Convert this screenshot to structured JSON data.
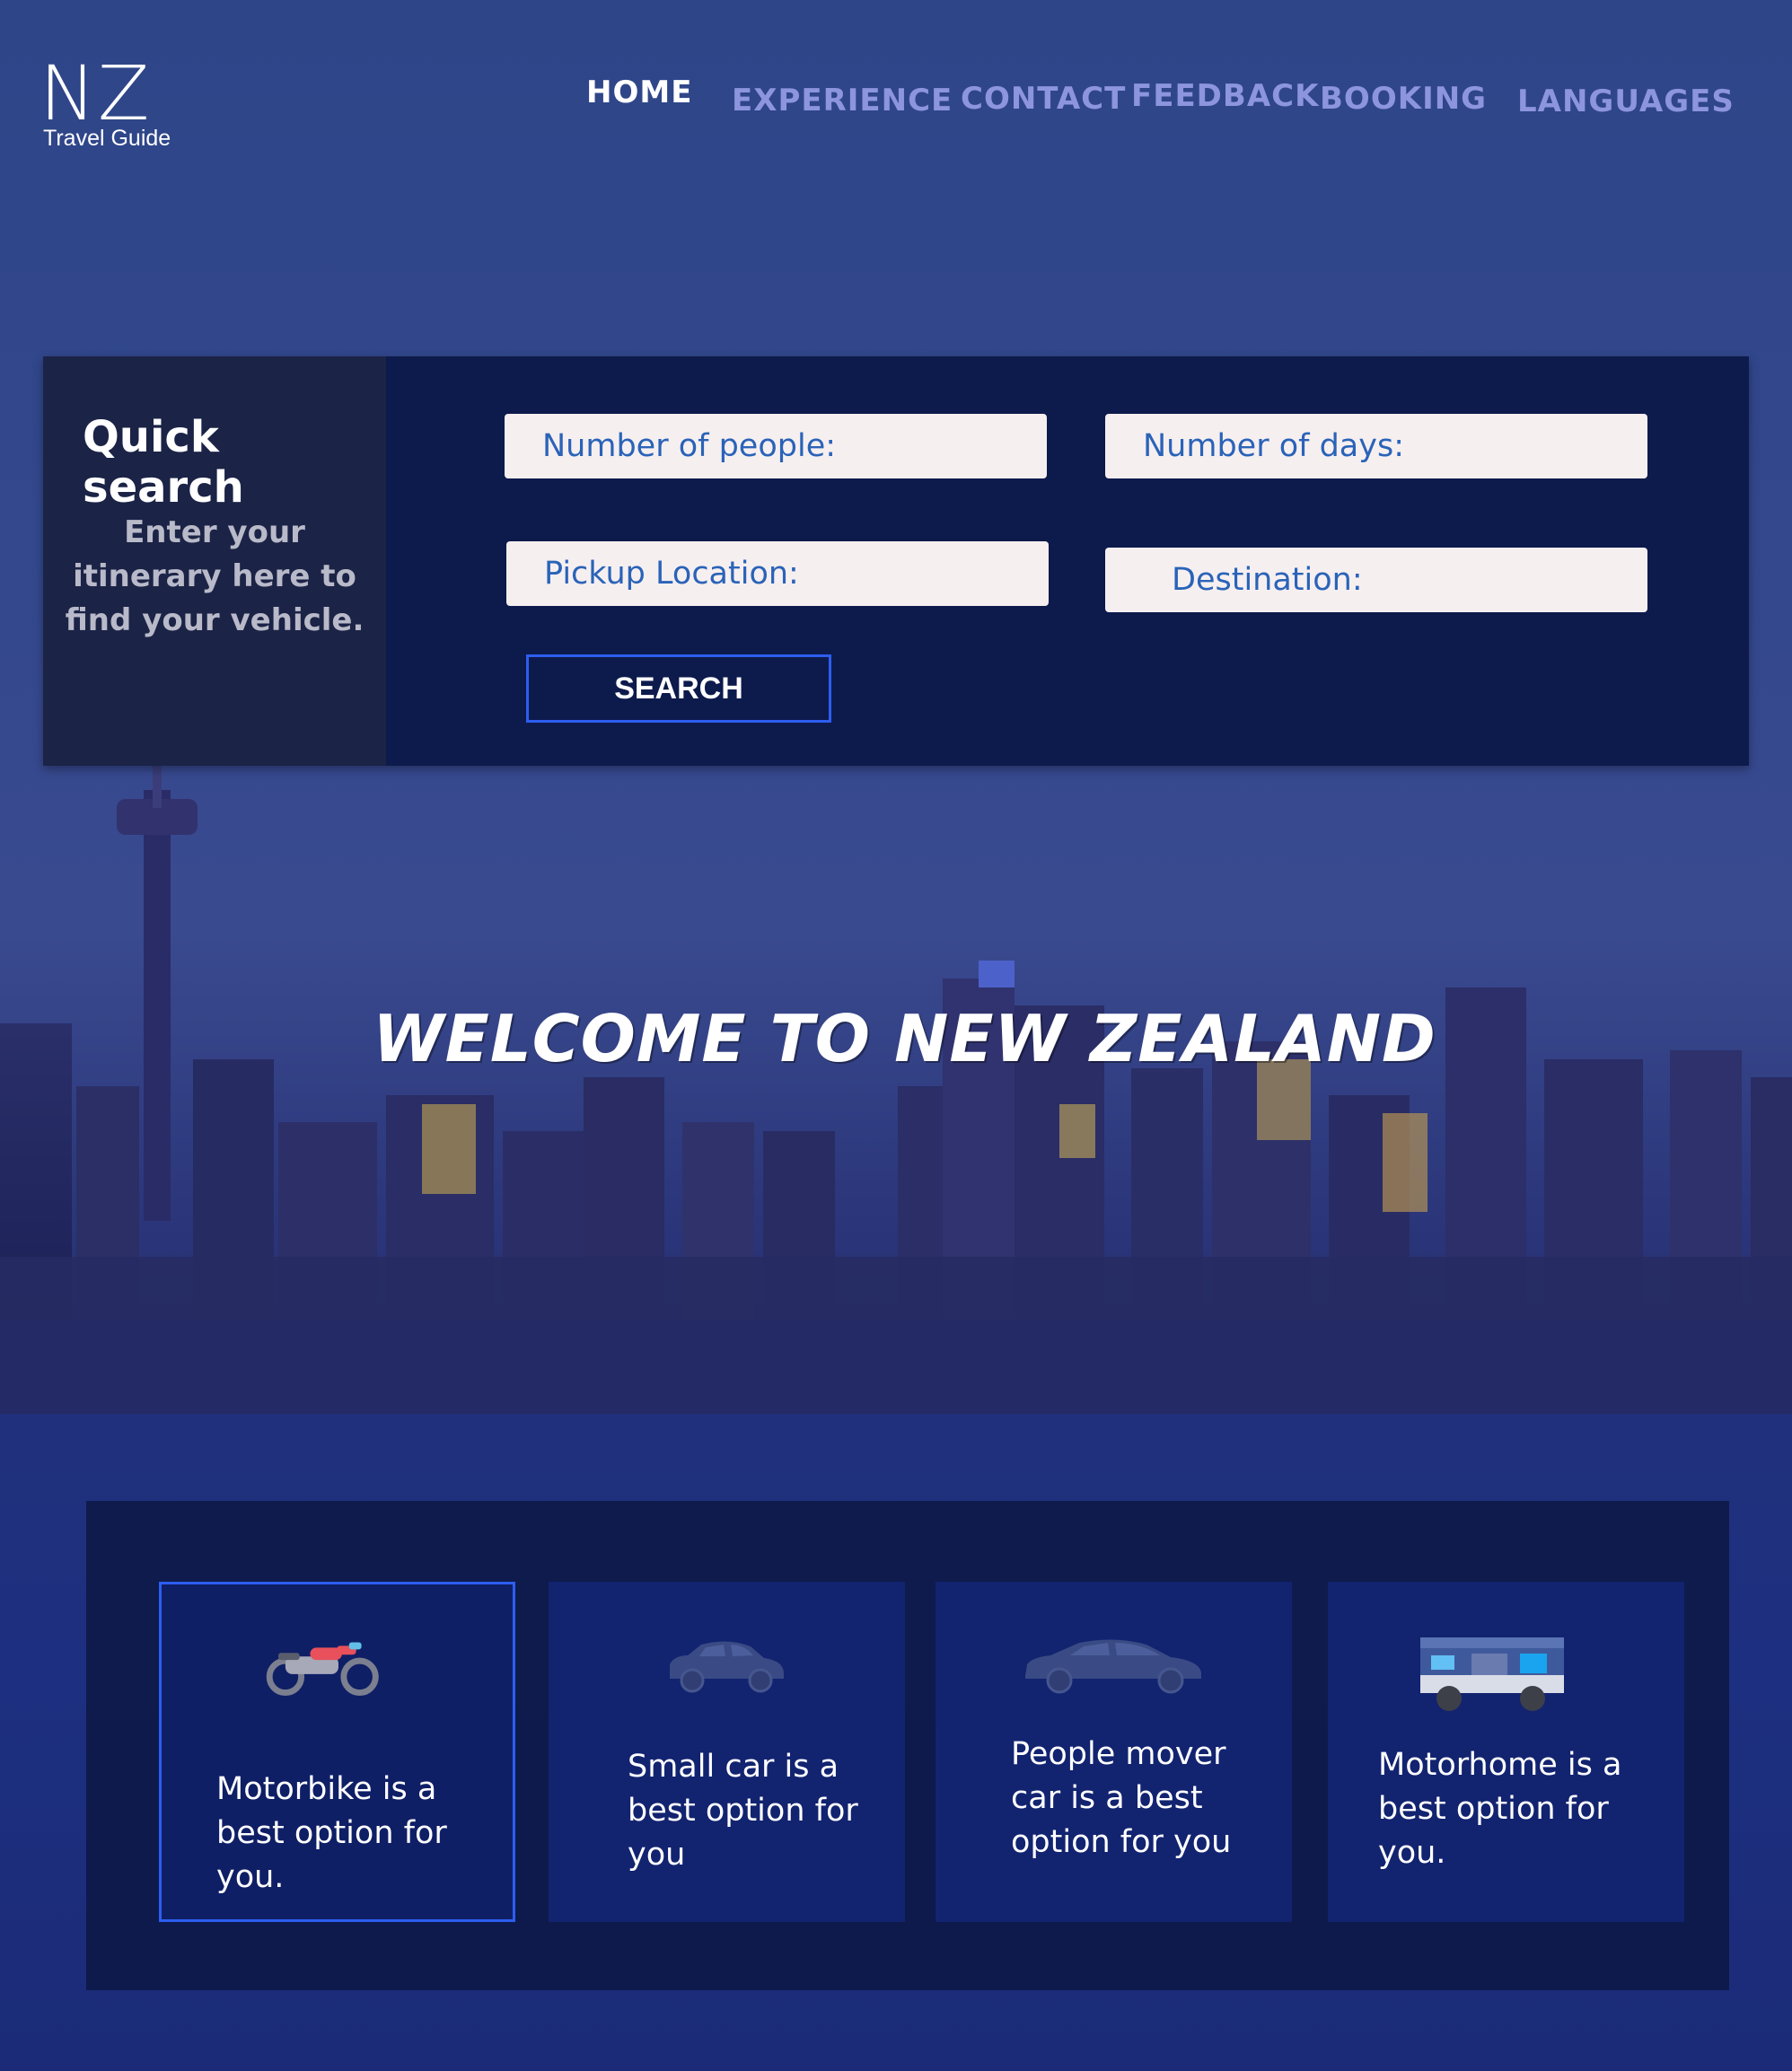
{
  "logo": {
    "mark": "NZ",
    "subtitle": "Travel Guide"
  },
  "nav": {
    "items": [
      {
        "label": "HOME",
        "active": true
      },
      {
        "label": "EXPERIENCE",
        "active": false
      },
      {
        "label": "CONTACT",
        "active": false
      },
      {
        "label": "FEEDBACK",
        "active": false
      },
      {
        "label": "BOOKING",
        "active": false
      },
      {
        "label": "LANGUAGES",
        "active": false
      }
    ]
  },
  "quick_search": {
    "title": "Quick search",
    "subtitle": "Enter your itinerary here to find your vehicle.",
    "fields": {
      "people_placeholder": "Number of people:",
      "days_placeholder": "Number of days:",
      "pickup_placeholder": "Pickup Location:",
      "destination_placeholder": "Destination:"
    },
    "search_label": "SEARCH"
  },
  "hero": {
    "title": "WELCOME TO NEW ZEALAND"
  },
  "vehicles": [
    {
      "icon": "motorbike-icon",
      "text": "Motorbike is a best option for you.",
      "selected": true
    },
    {
      "icon": "small-car-icon",
      "text": "Small car  is a best option for you",
      "selected": false
    },
    {
      "icon": "people-mover-car-icon",
      "text": "People mover car  is a best option for you",
      "selected": false
    },
    {
      "icon": "motorhome-icon",
      "text": "Motorhome  is a best option for you.",
      "selected": false
    }
  ],
  "colors": {
    "accent": "#2d5ef0",
    "nav_inactive": "#8c95dd",
    "panel_dark": "#0d1a4c",
    "field_bg": "#f6eff0",
    "field_text": "#2a63b8"
  }
}
